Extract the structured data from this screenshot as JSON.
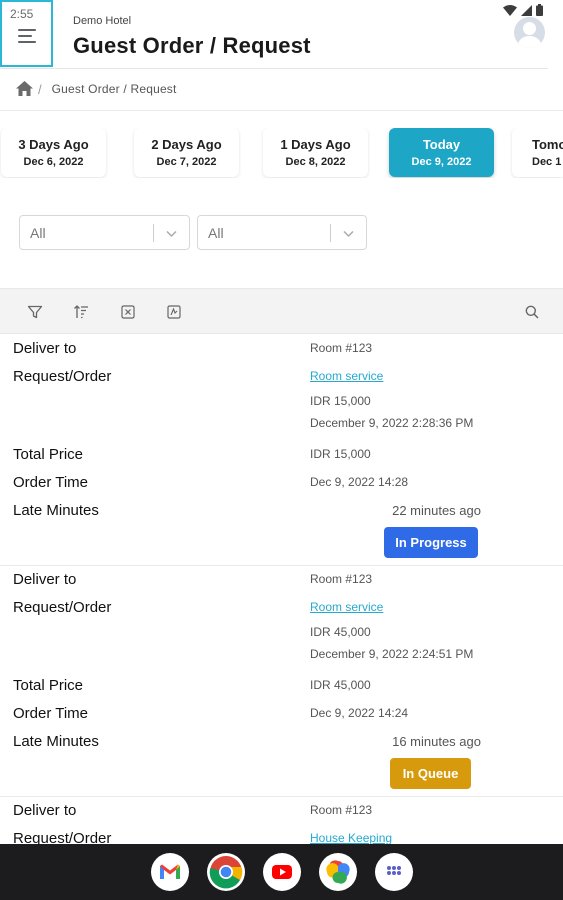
{
  "status_bar": {
    "time": "2:55"
  },
  "header": {
    "subtitle": "Demo Hotel",
    "title": "Guest Order / Request"
  },
  "breadcrumb": {
    "separator": "/",
    "current": "Guest Order / Request"
  },
  "date_tabs": [
    {
      "label": "3 Days Ago",
      "date": "Dec 6, 2022",
      "active": false
    },
    {
      "label": "2 Days Ago",
      "date": "Dec 7, 2022",
      "active": false
    },
    {
      "label": "1 Days Ago",
      "date": "Dec 8, 2022",
      "active": false
    },
    {
      "label": "Today",
      "date": "Dec 9, 2022",
      "active": true
    },
    {
      "label": "Tomo",
      "date": "Dec 1",
      "active": false
    }
  ],
  "filters": [
    {
      "value": "All"
    },
    {
      "value": "All"
    }
  ],
  "toolbar": {
    "icons": [
      "filter-icon",
      "sort-icon",
      "excel-export-icon",
      "pdf-export-icon",
      "search-icon"
    ]
  },
  "labels": {
    "deliver_to": "Deliver to",
    "request_order": "Request/Order",
    "total_price": "Total Price",
    "order_time": "Order Time",
    "late_minutes": "Late Minutes"
  },
  "records": [
    {
      "deliver_to": "Room #123",
      "request": "Room service",
      "request_price": "IDR 15,000",
      "request_datetime": "December 9, 2022 2:28:36 PM",
      "total_price": "IDR 15,000",
      "order_time": "Dec 9, 2022 14:28",
      "late_minutes": "22 minutes ago",
      "status": "In Progress",
      "status_color": "#2f6be6"
    },
    {
      "deliver_to": "Room #123",
      "request": "Room service",
      "request_price": "IDR 45,000",
      "request_datetime": "December 9, 2022 2:24:51 PM",
      "total_price": "IDR 45,000",
      "order_time": "Dec 9, 2022 14:24",
      "late_minutes": "16 minutes ago",
      "status": "In Queue",
      "status_color": "#d79a0c"
    },
    {
      "deliver_to": "Room #123",
      "request": "House Keeping"
    }
  ],
  "dock": {
    "apps": [
      "gmail-icon",
      "chrome-icon",
      "youtube-icon",
      "photos-icon",
      "app-drawer-icon"
    ]
  }
}
